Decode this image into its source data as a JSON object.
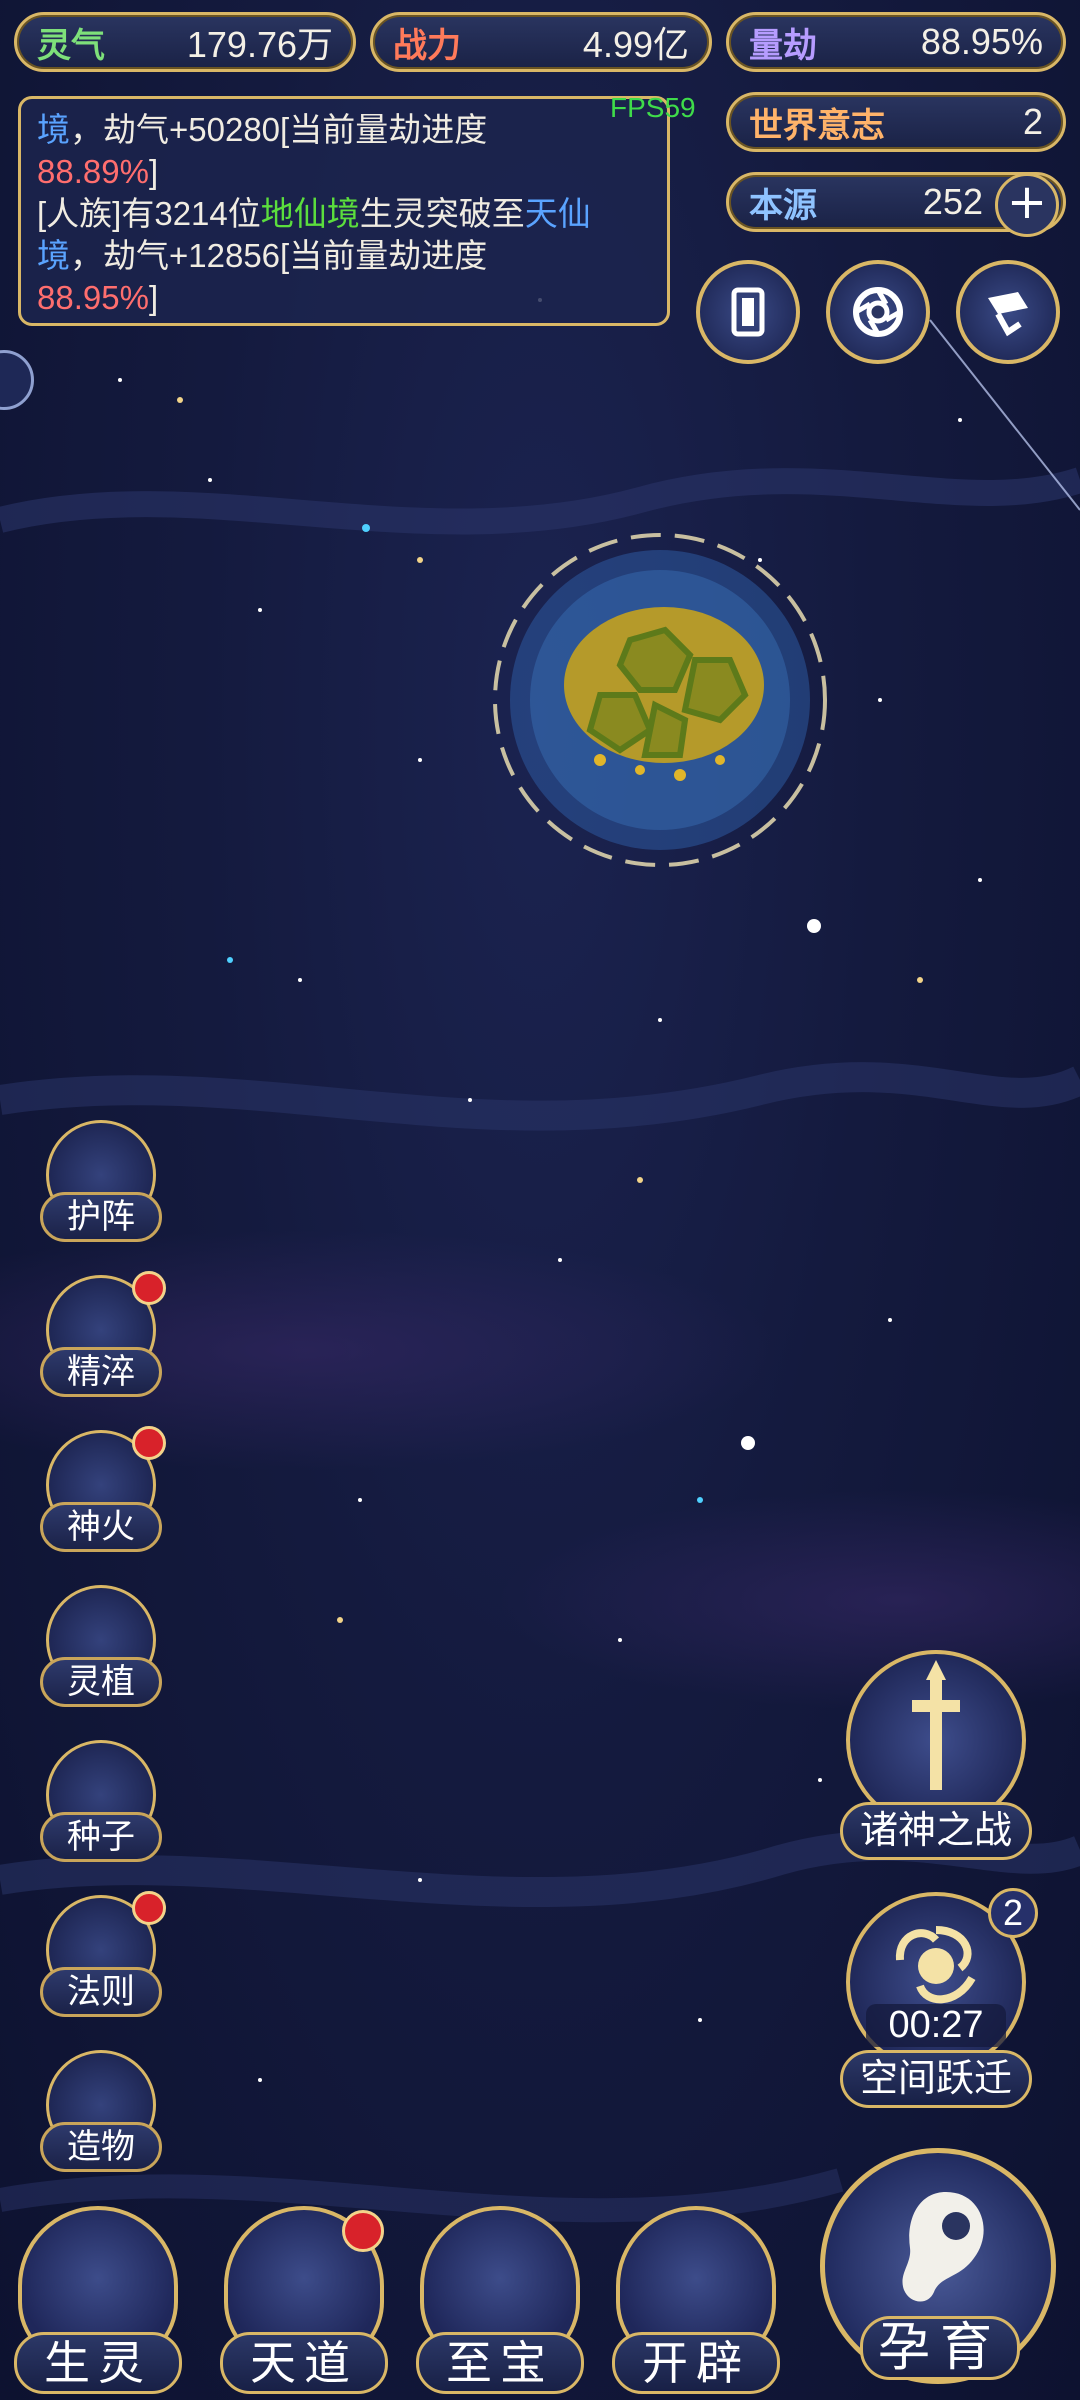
{
  "stats": {
    "lingqi": {
      "label": "灵气",
      "value": "179.76万"
    },
    "zhanli": {
      "label": "战力",
      "value": "4.99亿"
    },
    "liangjie": {
      "label": "量劫",
      "value": "88.95%"
    },
    "world_will": {
      "label": "世界意志",
      "value": "2"
    },
    "benyuan": {
      "label": "本源",
      "value": "252"
    }
  },
  "fps": "FPS59",
  "log": {
    "line1_a": "境",
    "line1_b": "，劫气+50280[当前量劫进度",
    "line1_pct": "88.89%",
    "line1_end": "]",
    "line2_a": "[人族]有3214位",
    "line2_green": "地仙境",
    "line2_b": "生灵突破至",
    "line2_blue": "天仙",
    "line3_blue": "境",
    "line3_b": "，劫气+12856[当前量劫进度",
    "line3_pct": "88.95%",
    "line3_end": "]"
  },
  "side_menu": [
    {
      "label": "护阵",
      "icon": "yin-yang-icon",
      "badge": false
    },
    {
      "label": "精淬",
      "icon": "lotus-flame-icon",
      "badge": true
    },
    {
      "label": "神火",
      "icon": "divine-fire-icon",
      "badge": true
    },
    {
      "label": "灵植",
      "icon": "spirit-plant-icon",
      "badge": false
    },
    {
      "label": "种子",
      "icon": "seed-flower-icon",
      "badge": false
    },
    {
      "label": "法则",
      "icon": "law-beast-icon",
      "badge": true
    },
    {
      "label": "造物",
      "icon": "creation-rune-icon",
      "badge": false
    }
  ],
  "bottom_nav": [
    {
      "label": "生灵",
      "icon": "creature-icon",
      "badge": false
    },
    {
      "label": "天道",
      "icon": "heaven-way-icon",
      "badge": true
    },
    {
      "label": "至宝",
      "icon": "treasure-icon",
      "badge": false
    },
    {
      "label": "开辟",
      "icon": "creation-flame-icon",
      "badge": false
    }
  ],
  "features": {
    "gods_war": {
      "label": "诸神之战",
      "icon": "sword-icon"
    },
    "space_jump": {
      "label": "空间跃迁",
      "timer": "00:27",
      "badge": "2",
      "icon": "vortex-icon"
    },
    "nurture": {
      "label": "孕育",
      "icon": "fetus-icon"
    }
  },
  "colors": {
    "gold": "#d9b766",
    "lingqi_label": "#7ee07a",
    "zhanli_label": "#ff7a5a",
    "liangjie_label": "#b69cff",
    "world_will_label": "#ffb36a",
    "benyuan_label": "#8fc3ff"
  }
}
